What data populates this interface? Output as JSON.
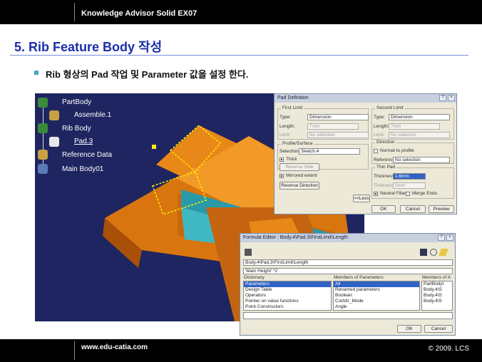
{
  "header": {
    "title": "Knowledge Advisor Solid EX07"
  },
  "slide": {
    "title": "5. Rib Feature Body 작성",
    "bullet": "Rib 형상의 Pad 작업 및 Parameter 값을 설정 한다."
  },
  "tree": {
    "items": [
      "PartBody",
      "Assemble.1",
      "Rib Body",
      "Pad.3",
      "Reference Data",
      "Main Body01"
    ]
  },
  "pad_dialog": {
    "title": "Pad Definition",
    "first_limit": {
      "label": "First Limit",
      "type_label": "Type:",
      "type_value": "Dimension",
      "length_label": "Length:",
      "length_value": "7mm",
      "limit_label": "Limit:",
      "limit_value": "No selection"
    },
    "profile": {
      "label": "Profile/Surface",
      "selection_label": "Selection:",
      "selection_value": "Sketch.4",
      "thick_label": "Thick",
      "reverse_side": "Reverse Side"
    },
    "mirrored_label": "Mirrored extent",
    "reverse_direction": "Reverse Direction",
    "less_button": "<<Less",
    "second_limit": {
      "label": "Second Limit",
      "type_label": "Type:",
      "type_value": "Dimension",
      "length_label": "Length:",
      "length_value": "7mm",
      "limit_label": "Limit:",
      "limit_value": "No selection"
    },
    "direction": {
      "label": "Direction",
      "normal_label": "Normal to profile",
      "reference_label": "Reference:",
      "reference_value": "No selection"
    },
    "thin_pad": {
      "label": "Thin Pad",
      "thickness1_label": "Thickness1:",
      "thickness1_value": "1.6mm",
      "thickness2_label": "Thickness2:",
      "thickness2_value": "0mm",
      "neutral_label": "Neutral Fiber",
      "merge_label": "Merge Ends"
    },
    "ok": "OK",
    "cancel": "Cancel",
    "preview": "Preview"
  },
  "formula_dialog": {
    "title": "Formula Editor : Body.4\\Pad.3\\FirstLimit\\Length",
    "path": "Body.4\\Pad.3\\FirstLimit\\Length",
    "formula": "'Main Height' *2",
    "dictionary_label": "Dictionary",
    "dictionary": [
      "Parameters",
      "Design Table",
      "Operators",
      "Pointer on value functions",
      "Point Constructors"
    ],
    "members_label": "Members of Parameters",
    "members": [
      "All",
      "Renamed parameters",
      "Boolean",
      "CstAttr_Mode",
      "Angle"
    ],
    "members_a_label": "Members of A",
    "members_a": [
      "PartBody\\",
      "Body.4\\S",
      "Body.4\\S",
      "Body.4\\S"
    ],
    "ok": "OK",
    "cancel": "Cancel"
  },
  "footer": {
    "url": "www.edu-catia.com",
    "copyright": "© 2009. LCS"
  }
}
